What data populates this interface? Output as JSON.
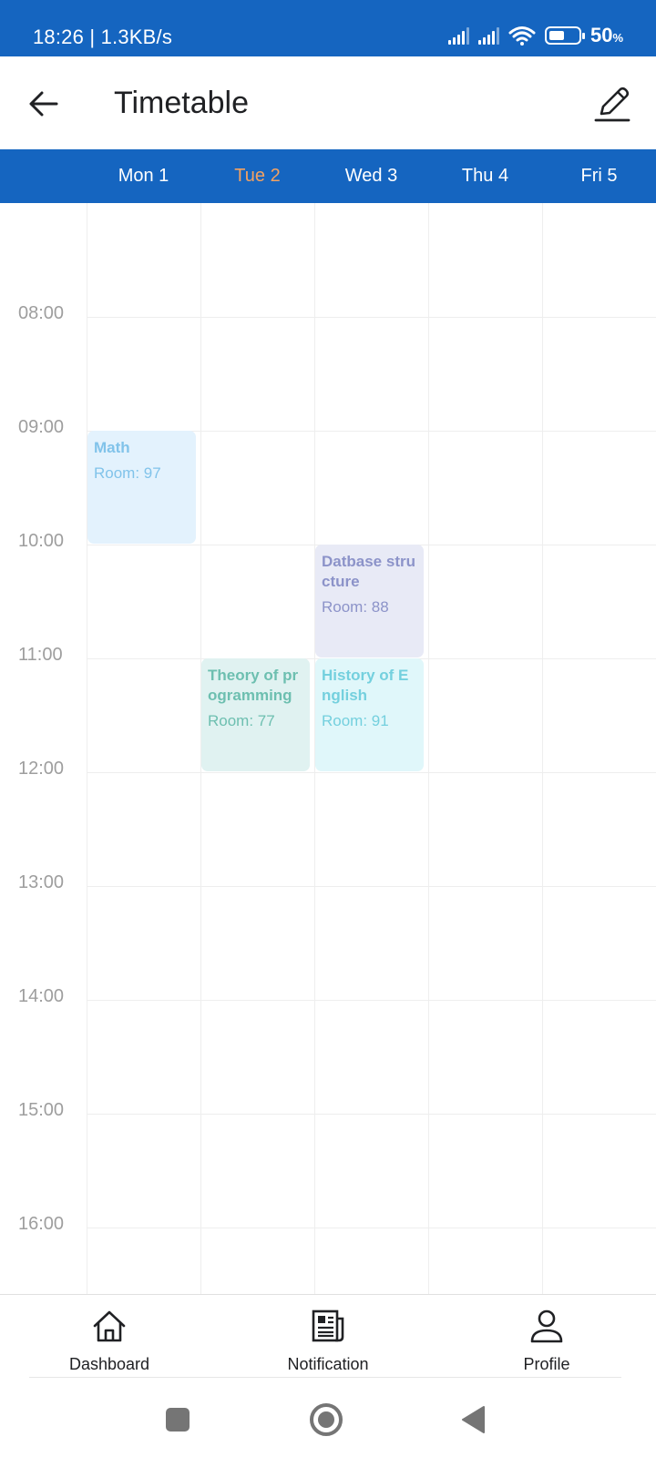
{
  "status_bar": {
    "time": "18:26 | 1.3KB/s",
    "battery": "50",
    "battery_unit": "%"
  },
  "app_bar": {
    "title": "Timetable"
  },
  "days": [
    {
      "label": "Mon 1",
      "selected": false
    },
    {
      "label": "Tue 2",
      "selected": true
    },
    {
      "label": "Wed 3",
      "selected": false
    },
    {
      "label": "Thu 4",
      "selected": false
    },
    {
      "label": "Fri 5",
      "selected": false
    }
  ],
  "time_labels": [
    "08:00",
    "09:00",
    "10:00",
    "11:00",
    "12:00",
    "13:00",
    "14:00",
    "15:00",
    "16:00"
  ],
  "events": [
    {
      "title": "Math",
      "room": "Room: 97",
      "day": 0,
      "start": "09:00",
      "end": "10:00",
      "bg": "#e3f2fd",
      "fg": "#81c3ea"
    },
    {
      "title": "Datbase structure",
      "room": "Room: 88",
      "day": 2,
      "start": "10:00",
      "end": "11:00",
      "bg": "#e8eaf6",
      "fg": "#8c93c9"
    },
    {
      "title": "Theory of programming",
      "room": "Room: 77",
      "day": 1,
      "start": "11:00",
      "end": "12:00",
      "bg": "#e0f2f1",
      "fg": "#6dbfb0"
    },
    {
      "title": "History of English",
      "room": "Room: 91",
      "day": 2,
      "start": "11:00",
      "end": "12:00",
      "bg": "#e0f7fa",
      "fg": "#74d0de"
    }
  ],
  "bottom_nav": [
    {
      "label": "Dashboard",
      "icon": "home-icon"
    },
    {
      "label": "Notification",
      "icon": "newspaper-icon"
    },
    {
      "label": "Profile",
      "icon": "person-icon"
    }
  ],
  "system_nav": [
    "square-icon",
    "circle-icon",
    "triangle-back-icon"
  ],
  "colors": {
    "primary": "#1565c0",
    "selected_day": "#f4a261",
    "grid_line": "#eeeeee",
    "time_label": "#9e9e9e"
  }
}
